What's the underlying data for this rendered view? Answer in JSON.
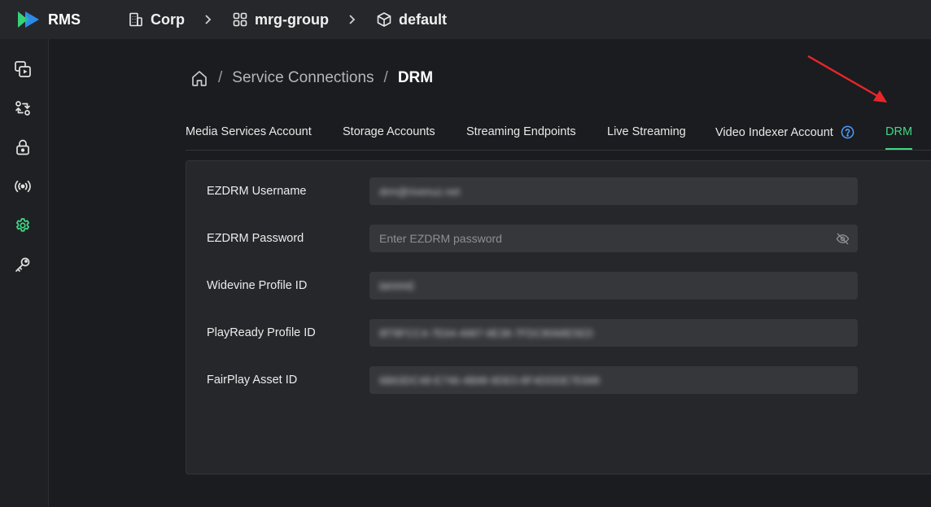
{
  "app": {
    "name": "RMS"
  },
  "topbar": {
    "crumbs": [
      {
        "label": "Corp",
        "icon": "building-icon"
      },
      {
        "label": "mrg-group",
        "icon": "grid-icon"
      },
      {
        "label": "default",
        "icon": "cube-icon"
      }
    ]
  },
  "rail": {
    "items": [
      {
        "icon": "media-icon",
        "active": false
      },
      {
        "icon": "sync-icon",
        "active": false
      },
      {
        "icon": "lock-icon",
        "active": false
      },
      {
        "icon": "broadcast-icon",
        "active": false
      },
      {
        "icon": "gear-icon",
        "active": true
      },
      {
        "icon": "key-icon",
        "active": false
      }
    ]
  },
  "breadcrumb": {
    "separator": "/",
    "parent": "Service Connections",
    "current": "DRM"
  },
  "tabs": [
    {
      "label": "Media Services Account",
      "active": false
    },
    {
      "label": "Storage Accounts",
      "active": false
    },
    {
      "label": "Streaming Endpoints",
      "active": false
    },
    {
      "label": "Live Streaming",
      "active": false
    },
    {
      "label": "Video Indexer Account",
      "active": false,
      "help": true
    },
    {
      "label": "DRM",
      "active": true
    }
  ],
  "form": {
    "ezdrm_username": {
      "label": "EZDRM Username",
      "value": "drm@rivenuz.net"
    },
    "ezdrm_password": {
      "label": "EZDRM Password",
      "value": "",
      "placeholder": "Enter EZDRM password"
    },
    "widevine_profile_id": {
      "label": "Widevine Profile ID",
      "value": "bkhhhE"
    },
    "playready_profile_id": {
      "label": "PlayReady Profile ID",
      "value": "8f78FCC4-7E64-4987-9E38-7FDC8068E5ED"
    },
    "fairplay_asset_id": {
      "label": "FairPlay Asset ID",
      "value": "6B63DC48-E746-4B98-9DE0-8F4DDDE7E688"
    }
  },
  "colors": {
    "accent": "#3fd884",
    "help": "#4b9dff",
    "arrow": "#e8262a",
    "logo_green": "#36d27a",
    "logo_blue": "#2d8ff0"
  }
}
